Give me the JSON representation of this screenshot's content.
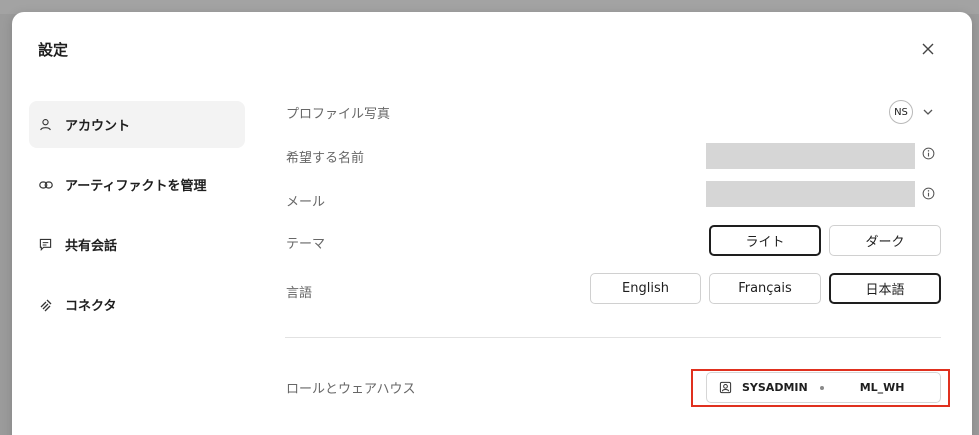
{
  "dialog": {
    "title": "設定"
  },
  "sidebar": {
    "items": [
      {
        "label": "アカウント",
        "icon": "user-icon",
        "active": true
      },
      {
        "label": "アーティファクトを管理",
        "icon": "link-icon",
        "active": false
      },
      {
        "label": "共有会話",
        "icon": "chat-icon",
        "active": false
      },
      {
        "label": "コネクタ",
        "icon": "connector-icon",
        "active": false
      }
    ]
  },
  "account": {
    "profile_photo_label": "プロファイル写真",
    "avatar_initials": "NS",
    "preferred_name_label": "希望する名前",
    "email_label": "メール",
    "theme_label": "テーマ",
    "theme_options": [
      "ライト",
      "ダーク"
    ],
    "theme_selected": "ライト",
    "language_label": "言語",
    "language_options": [
      "English",
      "Français",
      "日本語"
    ],
    "language_selected": "日本語",
    "role_label": "ロールとウェアハウス",
    "role": "SYSADMIN",
    "warehouse": "ML_WH"
  },
  "colors": {
    "highlight": "#e0301e",
    "selected_border": "#1e1e1e",
    "redacted": "#d6d6d6"
  }
}
